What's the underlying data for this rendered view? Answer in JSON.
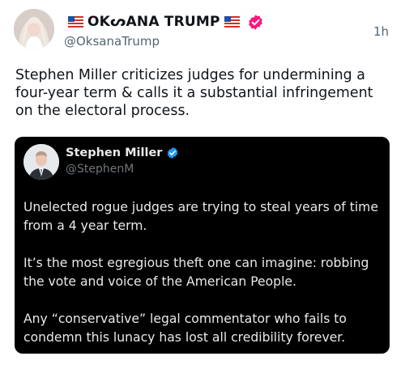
{
  "post": {
    "author_name": "OKᔕANA TRUMP",
    "author_handle": "@OksanaTrump",
    "timestamp": "1h",
    "text": "Stephen Miller criticizes judges for undermining a four-year term & calls it a substantial infringement on the electoral process.",
    "name_flags": [
      "us-flag-icon",
      "us-flag-icon"
    ],
    "verified_icon": "verified-badge-icon",
    "verified_color": "#f91880"
  },
  "quoted": {
    "author_name": "Stephen Miller",
    "author_handle": "@StephenM",
    "verified_icon": "verified-badge-icon",
    "verified_color": "#1d9bf0",
    "paragraphs": [
      "Unelected rogue judges are trying to steal years of time from a 4 year term.",
      "It’s the most egregious theft one can imagine: robbing the vote and voice of the American People.",
      "Any “conservative” legal commentator who fails to condemn this lunacy has lost all credibility forever."
    ]
  },
  "colors": {
    "text_primary": "#0f1419",
    "text_secondary": "#536471",
    "card_background": "#000000",
    "card_text": "#e7e9ea",
    "card_secondary": "#71767b"
  }
}
